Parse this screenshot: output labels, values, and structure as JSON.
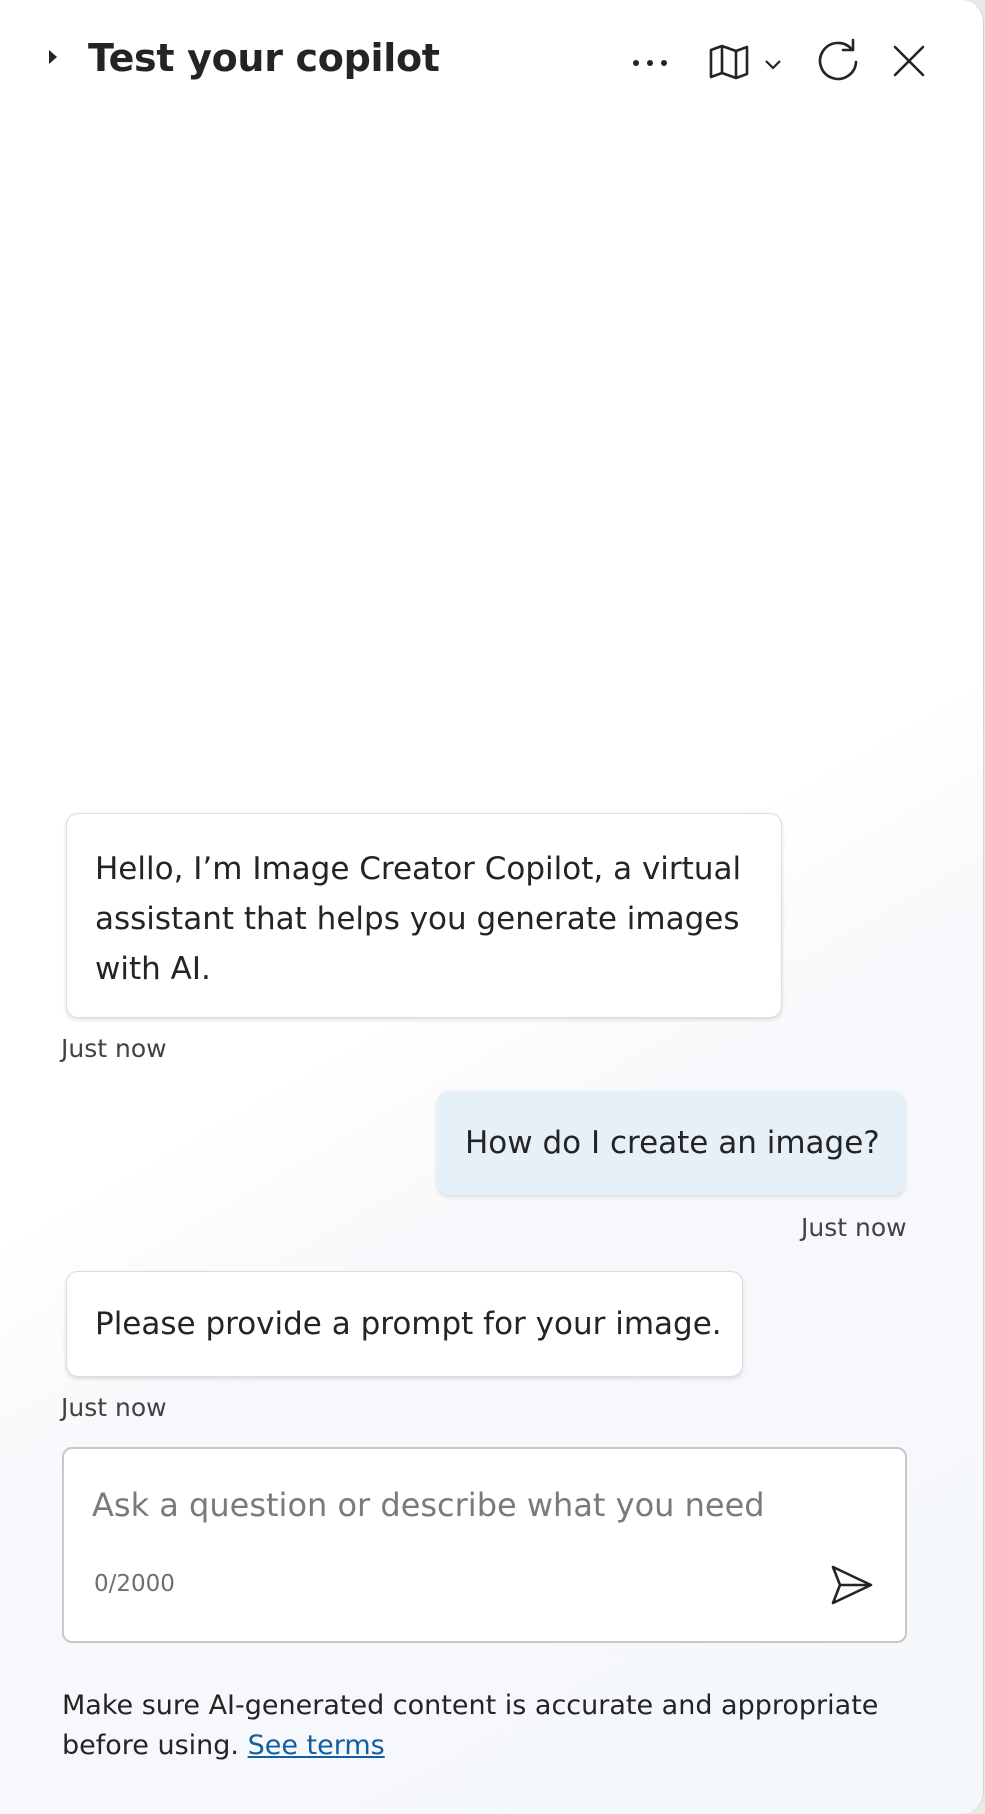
{
  "header": {
    "title": "Test your copilot",
    "icons": [
      "caret-right-icon",
      "more-icon",
      "map-icon",
      "chevron-down-icon",
      "refresh-icon",
      "close-icon"
    ]
  },
  "messages": [
    {
      "role": "bot",
      "text": "Hello, I’m Image Creator Copilot, a virtual assistant that helps you generate images with AI.",
      "timestamp": "Just now"
    },
    {
      "role": "user",
      "text": "How do I create an image?",
      "timestamp": "Just now"
    },
    {
      "role": "bot",
      "text": "Please provide a prompt for your image.",
      "timestamp": "Just now"
    }
  ],
  "composer": {
    "placeholder": "Ask a question or describe what you need",
    "value": "",
    "counter": "0/2000"
  },
  "footer": {
    "disclaimer": "Make sure AI-generated content is accurate and appropriate before using.",
    "link_label": "See terms"
  },
  "colors": {
    "user_bubble": "#e6f0f9",
    "link": "#115ea3",
    "text": "#242424"
  }
}
